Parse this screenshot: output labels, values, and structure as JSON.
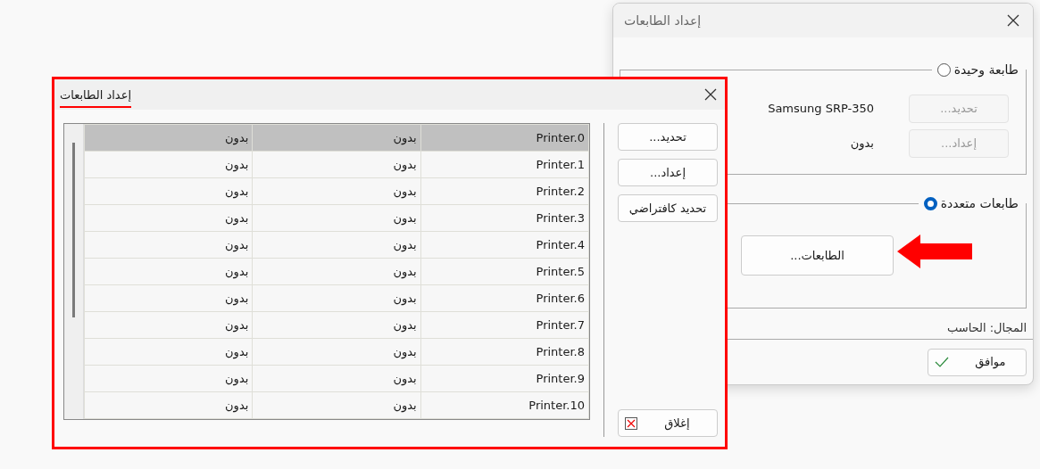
{
  "back_dialog": {
    "title": "إعداد الطابعات",
    "single_group": {
      "label": "طابعة وحيدة",
      "selected": false
    },
    "printer_name": "Samsung SRP-350",
    "printer_value": "بدون",
    "select_button": {
      "label": "تحديد...",
      "disabled": true
    },
    "setup_button": {
      "label": "إعداد...",
      "disabled": true
    },
    "multi_group": {
      "label": "طابعات متعددة",
      "selected": true
    },
    "printers_button": {
      "label": "الطابعات..."
    },
    "scope": "المجال: الحاسب",
    "ok_button": {
      "label": "موافق"
    }
  },
  "printers_dialog": {
    "title": "إعداد الطابعات",
    "rows": [
      {
        "cells": [
          "Printer.0",
          "بدون",
          "بدون"
        ],
        "selected": true
      },
      {
        "cells": [
          "Printer.1",
          "بدون",
          "بدون"
        ],
        "selected": false
      },
      {
        "cells": [
          "Printer.2",
          "بدون",
          "بدون"
        ],
        "selected": false
      },
      {
        "cells": [
          "Printer.3",
          "بدون",
          "بدون"
        ],
        "selected": false
      },
      {
        "cells": [
          "Printer.4",
          "بدون",
          "بدون"
        ],
        "selected": false
      },
      {
        "cells": [
          "Printer.5",
          "بدون",
          "بدون"
        ],
        "selected": false
      },
      {
        "cells": [
          "Printer.6",
          "بدون",
          "بدون"
        ],
        "selected": false
      },
      {
        "cells": [
          "Printer.7",
          "بدون",
          "بدون"
        ],
        "selected": false
      },
      {
        "cells": [
          "Printer.8",
          "بدون",
          "بدون"
        ],
        "selected": false
      },
      {
        "cells": [
          "Printer.9",
          "بدون",
          "بدون"
        ],
        "selected": false
      },
      {
        "cells": [
          "Printer.10",
          "بدون",
          "بدون"
        ],
        "selected": false
      }
    ],
    "buttons": [
      "تحديد...",
      "إعداد...",
      "تحديد كافتراضي"
    ],
    "close_button": "إغلاق"
  }
}
